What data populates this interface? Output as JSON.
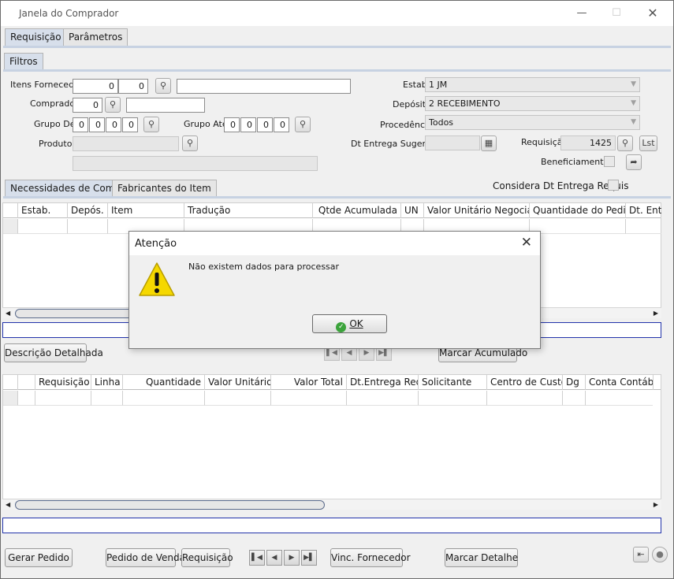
{
  "window": {
    "title": "Janela do Comprador"
  },
  "top_tabs": [
    {
      "label": "Requisição"
    },
    {
      "label": "Parâmetros"
    }
  ],
  "filters_tab": {
    "label": "Filtros"
  },
  "fields": {
    "itens_fornecedor": {
      "label": "Itens Fornecedor",
      "v1": "0",
      "v2": "0",
      "text": ""
    },
    "comprador": {
      "label": "Comprador",
      "value": "0",
      "text": ""
    },
    "grupo_de": {
      "label": "Grupo De",
      "values": [
        "0",
        "0",
        "0",
        "0"
      ]
    },
    "grupo_ate": {
      "label": "Grupo Até",
      "values": [
        "0",
        "0",
        "0",
        "0"
      ]
    },
    "produto": {
      "label": "Produto",
      "value": "",
      "desc": ""
    },
    "estab": {
      "label": "Estab.",
      "value": "1 JM"
    },
    "deposito": {
      "label": "Depósito",
      "value": "2 RECEBIMENTO"
    },
    "procedencia": {
      "label": "Procedência",
      "value": "Todos"
    },
    "dt_entrega_sugerida": {
      "label": "Dt Entrega Sugerida",
      "value": ""
    },
    "requisicao": {
      "label": "Requisição",
      "value": "1425",
      "lst": "Lst"
    },
    "beneficiamento": {
      "label": "Beneficiamento"
    },
    "considera": {
      "label": "Considera Dt Entrega Requis"
    }
  },
  "grid_tabs": [
    {
      "label": "Necessidades de Compra"
    },
    {
      "label": "Fabricantes do Item"
    }
  ],
  "grid1": {
    "columns": [
      "Estab.",
      "Depós.",
      "Item",
      "Tradução",
      "Qtde Acumulada",
      "UN",
      "Valor Unitário Negociado",
      "Quantidade do Pedido",
      "Dt. Entre"
    ]
  },
  "mid_buttons": {
    "descricao": "Descrição Detalhada",
    "marcar_acumulado": "Marcar Acumulado"
  },
  "grid2": {
    "columns": [
      "Requisição",
      "Linha",
      "Quantidade",
      "Valor Unitário",
      "Valor Total",
      "Dt.Entrega Req",
      "Solicitante",
      "Centro de Custo",
      "Dg",
      "Conta Contábil"
    ]
  },
  "bottom_buttons": {
    "gerar_pedido": "Gerar Pedido",
    "pedido_venda": "Pedido de Venda",
    "requisicao": "Requisição",
    "vinc_fornecedor": "Vinc. Fornecedor",
    "marcar_detalhe": "Marcar Detalhe"
  },
  "dialog": {
    "title": "Atenção",
    "message": "Não existem dados para processar",
    "ok": "OK"
  },
  "colors": {
    "accent_band": "#2233aa",
    "tab_active": "#d7dfeb",
    "warning": "#f5d800",
    "ok_icon": "#3ba33b"
  },
  "icons": [
    "search-icon",
    "calendar-icon",
    "forward-arrow-icon",
    "warning-icon",
    "ok-check-icon",
    "exit-icon",
    "record-icon"
  ]
}
